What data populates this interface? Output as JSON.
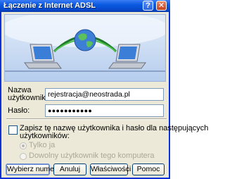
{
  "window": {
    "title": "Łączenie z Internet ADSL",
    "help_label": "?",
    "close_label": "✕"
  },
  "form": {
    "username_label_line1": "Nazwa",
    "username_label_line2": "użytkownika:",
    "username_value": "rejestracja@neostrada.pl",
    "password_label": "Hasło:",
    "password_value": "●●●●●●●●●●●"
  },
  "save": {
    "checkbox_label_line1": "Zapisz tę nazwę użytkownika i hasło dla następujących",
    "checkbox_label_line2": "użytkowników:",
    "checked": false,
    "option_me": "Tylko ja",
    "option_anyone": "Dowolny użytkownik tego komputera"
  },
  "buttons": {
    "dial": "Wybierz numer",
    "cancel": "Anuluj",
    "properties": "Właściwości",
    "help": "Pomoc"
  },
  "colors": {
    "titlebar": "#0a5ae0",
    "dialog": "#ece9d8",
    "banner_top": "#e3edf9",
    "banner_bottom": "#b6cdee"
  }
}
